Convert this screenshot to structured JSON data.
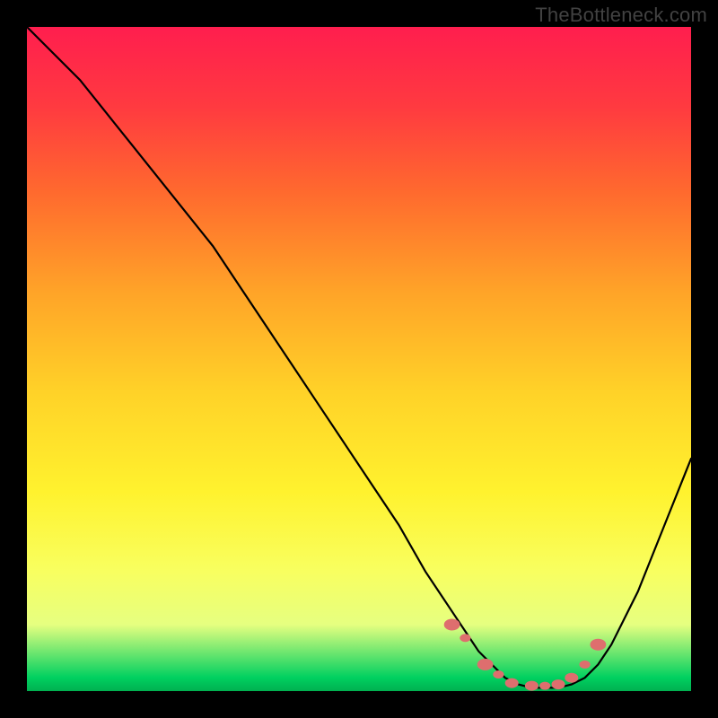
{
  "watermark": "TheBottleneck.com",
  "colors": {
    "frame_bg": "#000000",
    "curve_stroke": "#000000",
    "dot_fill": "#de6e6e",
    "gradient_top": "#ff1e4e",
    "gradient_bottom": "#00b050"
  },
  "chart_data": {
    "type": "line",
    "title": "",
    "xlabel": "",
    "ylabel": "",
    "xlim": [
      0,
      100
    ],
    "ylim": [
      0,
      100
    ],
    "grid": false,
    "legend": false,
    "series": [
      {
        "name": "bottleneck-curve",
        "x": [
          0,
          4,
          8,
          12,
          16,
          20,
          24,
          28,
          32,
          36,
          40,
          44,
          48,
          52,
          56,
          60,
          62,
          64,
          66,
          68,
          70,
          72,
          74,
          76,
          78,
          80,
          82,
          84,
          86,
          88,
          90,
          92,
          94,
          96,
          98,
          100
        ],
        "y": [
          100,
          96,
          92,
          87,
          82,
          77,
          72,
          67,
          61,
          55,
          49,
          43,
          37,
          31,
          25,
          18,
          15,
          12,
          9,
          6,
          4,
          2,
          1,
          0.5,
          0.5,
          0.5,
          1,
          2,
          4,
          7,
          11,
          15,
          20,
          25,
          30,
          35
        ]
      }
    ],
    "markers": [
      {
        "x": 64,
        "y": 10,
        "r": 6
      },
      {
        "x": 66,
        "y": 8,
        "r": 4
      },
      {
        "x": 69,
        "y": 4,
        "r": 6
      },
      {
        "x": 71,
        "y": 2.5,
        "r": 4
      },
      {
        "x": 73,
        "y": 1.2,
        "r": 5
      },
      {
        "x": 76,
        "y": 0.8,
        "r": 5
      },
      {
        "x": 78,
        "y": 0.8,
        "r": 4
      },
      {
        "x": 80,
        "y": 1,
        "r": 5
      },
      {
        "x": 82,
        "y": 2,
        "r": 5
      },
      {
        "x": 84,
        "y": 4,
        "r": 4
      },
      {
        "x": 86,
        "y": 7,
        "r": 6
      }
    ]
  }
}
